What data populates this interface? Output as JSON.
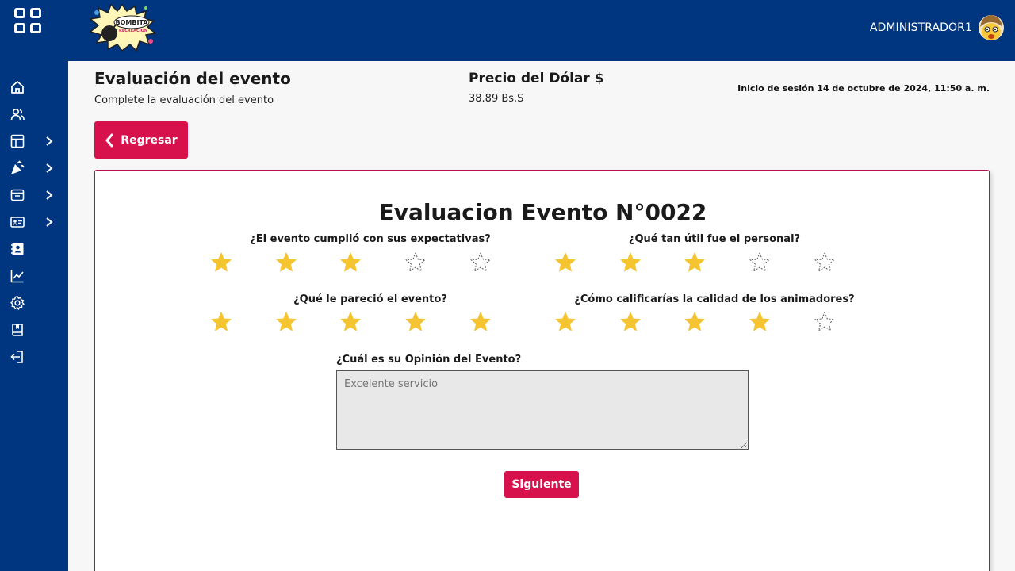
{
  "topbar": {
    "user_name": "ADMINISTRADOR1",
    "logo_text_line1": "BOMBITA",
    "logo_text_line2": "RECREACION"
  },
  "sidebar": {
    "items": [
      {
        "icon": "home-icon",
        "has_submenu": false
      },
      {
        "icon": "users-icon",
        "has_submenu": false
      },
      {
        "icon": "layout-icon",
        "has_submenu": true
      },
      {
        "icon": "party-icon",
        "has_submenu": true
      },
      {
        "icon": "inbox-icon",
        "has_submenu": true
      },
      {
        "icon": "id-card-icon",
        "has_submenu": true
      },
      {
        "icon": "contact-book-icon",
        "has_submenu": false
      },
      {
        "icon": "chart-line-icon",
        "has_submenu": false
      },
      {
        "icon": "gear-icon",
        "has_submenu": false
      },
      {
        "icon": "book-icon",
        "has_submenu": false
      },
      {
        "icon": "logout-icon",
        "has_submenu": false
      }
    ]
  },
  "header": {
    "title": "Evaluación del evento",
    "subtitle": "Complete la evaluación del evento",
    "dollar_title": "Precio del Dólar $",
    "dollar_value": "38.89 Bs.S",
    "session_text": "Inicio de sesión 14 de octubre de 2024, 11:50 a. m."
  },
  "back_button": {
    "label": "Regresar"
  },
  "evaluation": {
    "title": "Evaluacion Evento N°0022",
    "max_rating": 5,
    "questions": [
      {
        "label": "¿El evento cumplió con sus expectativas?",
        "rating": 3
      },
      {
        "label": "¿Qué tan útil fue el personal?",
        "rating": 3
      },
      {
        "label": "¿Qué le pareció el evento?",
        "rating": 5
      },
      {
        "label": "¿Cómo calificarías la calidad de los animadores?",
        "rating": 4
      }
    ],
    "opinion_label": "¿Cuál es su Opinión del Evento?",
    "opinion_placeholder": "Excelente servicio",
    "next_label": "Siguiente"
  },
  "colors": {
    "primary_blue": "#003580",
    "accent_red": "#d6114c",
    "star_filled": "#f5c431"
  }
}
